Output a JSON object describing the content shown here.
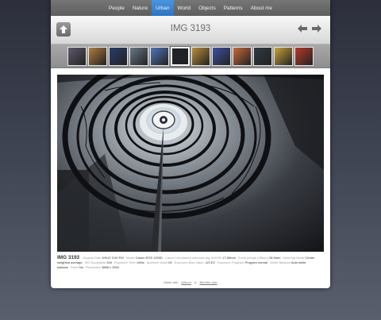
{
  "nav": {
    "items": [
      {
        "label": "People"
      },
      {
        "label": "Nature"
      },
      {
        "label": "Urban"
      },
      {
        "label": "World"
      },
      {
        "label": "Objects"
      },
      {
        "label": "Patterns"
      },
      {
        "label": "About me"
      }
    ],
    "active_index": 2
  },
  "header": {
    "title": "IMG 3193",
    "up_icon": "up-arrow-icon",
    "prev_icon": "left-arrow-icon",
    "next_icon": "right-arrow-icon"
  },
  "thumbnails": {
    "count": 12,
    "active_index": 5,
    "colors": [
      "#5f5a6d",
      "#b27c3f",
      "#2b3d6a",
      "#6a7789",
      "#4f75b8",
      "#202228",
      "#b98e3c",
      "#3f4fa1",
      "#c8683a",
      "#2f3a44",
      "#c9a33a",
      "#b83a2a"
    ]
  },
  "caption": {
    "title": "IMG 3193",
    "exif": [
      {
        "k": "Original Date",
        "v": "5/9/12 3:00 PM"
      },
      {
        "k": "Model",
        "v": "Canon EOS 1000D"
      },
      {
        "k": "Canon Ltd.camera unknown tag 0x0095",
        "v": "17-55mm"
      },
      {
        "k": "Focal Length (35mm)",
        "v": "28.9mm"
      },
      {
        "k": "Metering Mode",
        "v": "Center weighted average"
      },
      {
        "k": "ISO Equivalent",
        "v": "400"
      },
      {
        "k": "Exposure Time",
        "v": "1/60s"
      },
      {
        "k": "Aperture Value",
        "v": "f/4"
      },
      {
        "k": "Exposure Bias Value",
        "v": "-1/3 EV"
      },
      {
        "k": "Exposure Program",
        "v": "Program normal"
      },
      {
        "k": "White Balance",
        "v": "Auto white balance"
      },
      {
        "k": "Flash",
        "v": "No"
      },
      {
        "k": "Resolution",
        "v": "3888 x 2592"
      }
    ]
  },
  "footer": {
    "made_with": "Made with",
    "jalbum": "jAlbum",
    "amp": "&",
    "skin": "BeeSite skin"
  }
}
